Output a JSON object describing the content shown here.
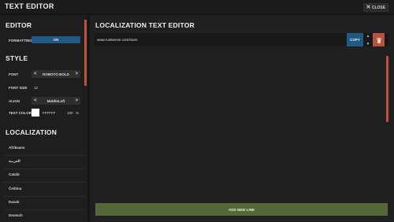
{
  "window": {
    "title": "TEXT EDITOR",
    "close_label": "CLOSE"
  },
  "editor": {
    "heading": "EDITOR",
    "formatting_label": "FORMATTING",
    "formatting_value": "ON"
  },
  "style": {
    "heading": "STYLE",
    "font_label": "FONT",
    "font_value": "ROBOTO BOLD",
    "font_size_label": "FONT SIZE",
    "font_size_value": "12",
    "align_label": "ALIGN",
    "align_value": "MiddleLeft",
    "text_color_label": "TEXT COLOR",
    "text_color_hex": "FFFFFF",
    "text_color_alpha": "100",
    "text_color_alpha_unit": "%",
    "swatch_color": "#ffffff",
    "prev_glyph": "<",
    "next_glyph": ">"
  },
  "localization": {
    "heading": "LOCALIZATION",
    "languages": [
      "Afrikaans",
      "العربية",
      "Català",
      "Čeština",
      "Dansk",
      "Deutsch"
    ]
  },
  "main": {
    "title": "LOCALIZATION TEXT EDITOR",
    "lines": [
      {
        "text": "www.rustserver.com/store"
      }
    ],
    "copy_label": "COPY",
    "up_glyph": "▲",
    "down_glyph": "▼",
    "add_line_label": "ADD NEW LINE"
  },
  "colors": {
    "accent_blue": "#1f5a85",
    "danger_red": "#b5533f",
    "scrollbar": "#c2513c",
    "add_green": "#55683a"
  }
}
